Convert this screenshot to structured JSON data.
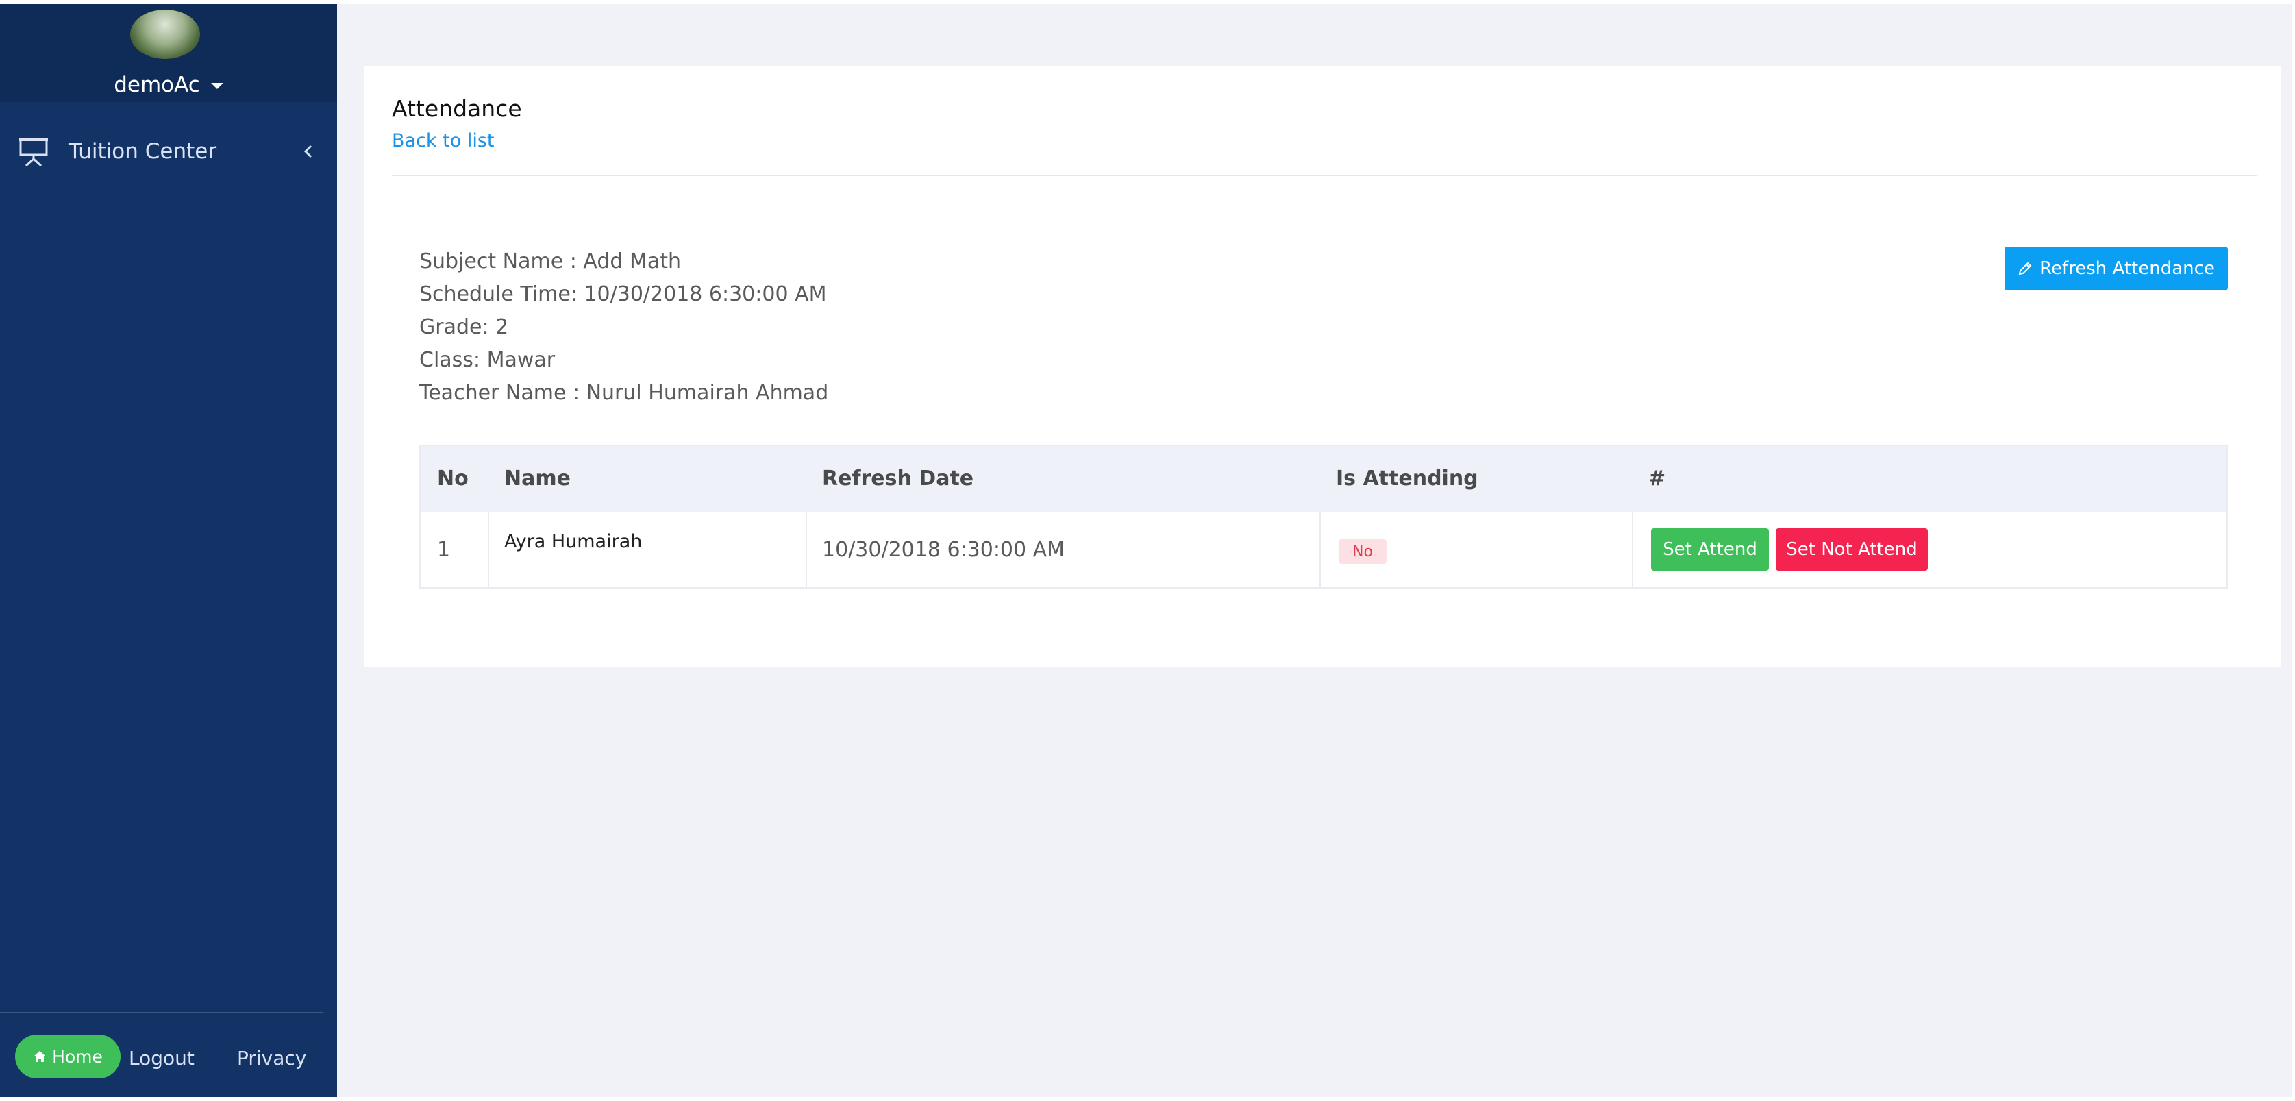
{
  "sidebar": {
    "username": "demoAc",
    "nav": [
      {
        "label": "Tuition Center",
        "icon": "presentation-board-icon"
      }
    ],
    "footer": {
      "home_label": "Home",
      "logout_label": "Logout",
      "privacy_label": "Privacy"
    }
  },
  "page": {
    "title": "Attendance",
    "back_link": "Back to list",
    "refresh_button": "Refresh Attendance",
    "info": {
      "subject": "Subject Name : Add Math",
      "schedule": "Schedule Time: 10/30/2018 6:30:00 AM",
      "grade": "Grade: 2",
      "class": "Class: Mawar",
      "teacher": "Teacher Name : Nurul Humairah Ahmad"
    }
  },
  "table": {
    "headers": [
      "No",
      "Name",
      "Refresh Date",
      "Is Attending",
      "#"
    ],
    "rows": [
      {
        "no": "1",
        "name": "Ayra Humairah",
        "refresh_date": "10/30/2018 6:30:00 AM",
        "attending": "No",
        "actions": {
          "attend": "Set Attend",
          "not_attend": "Set Not Attend"
        }
      }
    ]
  },
  "colors": {
    "sidebar": "#133366",
    "accent_blue": "#0a9ff2",
    "success": "#3fbf5a",
    "danger": "#f4234f"
  }
}
